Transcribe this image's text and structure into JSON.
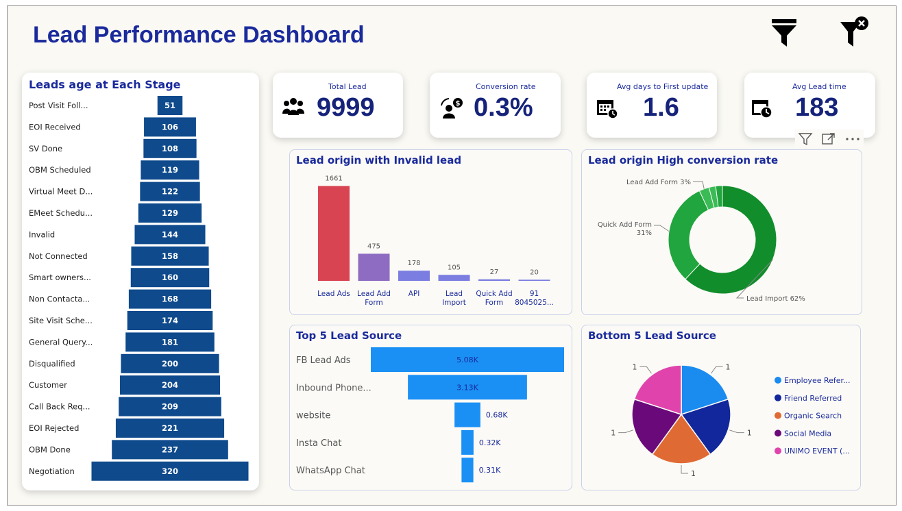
{
  "header": {
    "title": "Lead Performance Dashboard"
  },
  "top_icons": [
    "funnel-filter-icon",
    "clear-filter-icon"
  ],
  "kpis": [
    {
      "label": "Total Lead",
      "value": "9999",
      "icon": "people-icon"
    },
    {
      "label": "Conversion rate",
      "value": "0.3%",
      "icon": "person-money-icon"
    },
    {
      "label": "Avg days to First update",
      "value": "1.6",
      "icon": "calendar-clock-icon"
    },
    {
      "label": "Avg Lead time",
      "value": "183",
      "icon": "calendar-timer-icon"
    }
  ],
  "visual_toolbar": [
    "filter-icon",
    "focus-mode-icon",
    "more-options-icon"
  ],
  "colors": {
    "title": "#1a2a9c",
    "stage_bar": "#0e4a8c",
    "invalid_bar_red": "#d94452",
    "invalid_bar_purple": "#8e6cc2",
    "invalid_bar_blue": "#7b7ee0",
    "donut_dark": "#118d2b",
    "donut_mid": "#21a53e",
    "donut_light": "#3bbb56",
    "top5_bar": "#1a90f5"
  },
  "chart_data": [
    {
      "type": "bar",
      "orientation": "horizontal-funnel",
      "title": "Leads age at Each Stage",
      "categories": [
        "Post Visit Foll...",
        "EOI Received",
        "SV Done",
        "OBM Scheduled",
        "Virtual Meet D...",
        "EMeet Schedu...",
        "Invalid",
        "Not Connected",
        "Smart owners...",
        "Non Contacta...",
        "Site Visit Sche...",
        "General Query...",
        "Disqualified",
        "Customer",
        "Call Back Req...",
        "EOI Rejected",
        "OBM Done",
        "Negotiation"
      ],
      "values": [
        51,
        106,
        108,
        119,
        122,
        129,
        144,
        158,
        160,
        168,
        174,
        181,
        200,
        204,
        209,
        221,
        237,
        320
      ]
    },
    {
      "type": "bar",
      "title": "Lead origin with Invalid lead",
      "categories": [
        [
          "Lead Ads"
        ],
        [
          "Lead Add",
          "Form"
        ],
        [
          "API"
        ],
        [
          "Lead",
          "Import"
        ],
        [
          "Quick Add",
          "Form"
        ],
        [
          "91",
          "8045025..."
        ]
      ],
      "values": [
        1661,
        475,
        178,
        105,
        27,
        20
      ],
      "ylim": [
        0,
        1800
      ]
    },
    {
      "type": "pie",
      "style": "donut",
      "title": "Lead origin High conversion rate",
      "slices": [
        {
          "label": "Lead Import 62%",
          "value": 62
        },
        {
          "label": "Quick Add Form 31%",
          "value": 31
        },
        {
          "label": "Lead Add Form 3%",
          "value": 3
        },
        {
          "label": "",
          "value": 2
        },
        {
          "label": "",
          "value": 2
        }
      ]
    },
    {
      "type": "bar",
      "orientation": "horizontal-funnel",
      "title": "Top 5 Lead Source",
      "categories": [
        "FB Lead Ads",
        "Inbound Phone...",
        "website",
        "Insta Chat",
        "WhatsApp Chat"
      ],
      "values": [
        5.08,
        3.13,
        0.68,
        0.32,
        0.31
      ],
      "data_labels": [
        "5.08K",
        "3.13K",
        "0.68K",
        "0.32K",
        "0.31K"
      ],
      "unit": "K"
    },
    {
      "type": "pie",
      "title": "Bottom 5 Lead Source",
      "series": [
        {
          "name": "Employee Refer...",
          "value": 1,
          "color": "#1a8cf0"
        },
        {
          "name": "Friend Referred",
          "value": 1,
          "color": "#12279b"
        },
        {
          "name": "Organic Search",
          "value": 1,
          "color": "#e06a33"
        },
        {
          "name": "Social Media",
          "value": 1,
          "color": "#6a0a7a"
        },
        {
          "name": "UNIMO EVENT (...",
          "value": 1,
          "color": "#e044ac"
        }
      ],
      "data_labels": [
        "1",
        "1",
        "1",
        "1",
        "1"
      ],
      "legend": "right"
    }
  ]
}
